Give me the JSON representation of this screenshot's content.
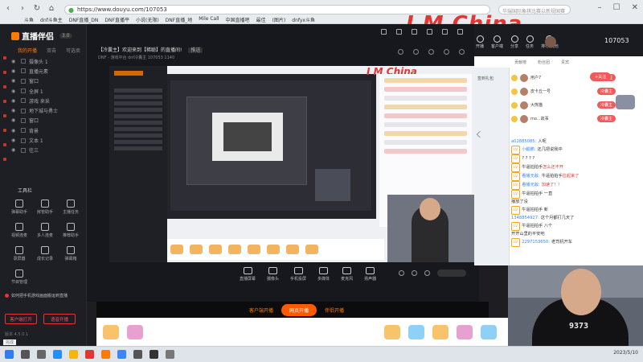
{
  "browser": {
    "url": "https://www.douyu.com/107053",
    "search_placeholder": "华瑞国际象棋比赛以新规国赛",
    "bookmarks": [
      "斗鱼",
      "dnf斗鱼主",
      "DNF直播_DN",
      "DNF直播平",
      "小说(无限)",
      "DNF直播_地",
      "Mile Call",
      "中国直播吧",
      "最佳",
      "(图片)",
      "dnfyx斗鱼"
    ]
  },
  "overlay_text": "I M China",
  "app": {
    "name": "直播伴侣",
    "version": "3.0",
    "tabs": [
      "我的开播",
      "双击",
      "可选卖"
    ],
    "scenes": [
      {
        "label": "摄像头 1"
      },
      {
        "label": "直播元素"
      },
      {
        "label": "窗口"
      },
      {
        "label": "全屏 1"
      },
      {
        "label": "游戏 来采"
      },
      {
        "label": "地下城与勇士"
      },
      {
        "label": "窗口"
      },
      {
        "label": "背景"
      },
      {
        "label": "文本 1"
      },
      {
        "label": "往三"
      }
    ],
    "tools_title": "工具栏",
    "tools": [
      {
        "label": "弹幕助手"
      },
      {
        "label": "房管助手"
      },
      {
        "label": "主播任务"
      },
      {
        "label": "视频连麦"
      },
      {
        "label": "多人连麦"
      },
      {
        "label": "推荐助手"
      },
      {
        "label": "录屏器"
      },
      {
        "label": "成长记录"
      },
      {
        "label": "弹幕箱"
      },
      {
        "label": "节目管理"
      }
    ],
    "notice": "如何把手机游戏画面搬运到直播",
    "buttons": {
      "phone_live": "客户端打开",
      "voice_live": "语音开播"
    },
    "version_text": "版本 4.5.0.1"
  },
  "stream": {
    "room_title": "【冷囊主】欢迎来到【稀聪】的直播间!",
    "tag": "推送",
    "meta": "DNF - 游戏平台  dnf冷囊主  107053  1140",
    "controls": [
      {
        "label": "直播屏幕"
      },
      {
        "label": "摄像头"
      },
      {
        "label": "手机投屏"
      },
      {
        "label": "多媒体"
      },
      {
        "label": "麦克风"
      },
      {
        "label": "扬声器"
      }
    ],
    "live_links": {
      "left": "客户端开播",
      "center": "网页开播",
      "right": "伴侣开播"
    }
  },
  "right_panel": {
    "top_icons": [
      "开播",
      "客户端",
      "分享",
      "任务",
      "排行/其他"
    ],
    "room_id": "107053",
    "header": [
      "贡献榜",
      "粉丝团",
      "贵宾"
    ],
    "sidebar_label": "签到礼包",
    "rank": [
      {
        "name": "用户7",
        "pill": "关注"
      },
      {
        "name": "皮卡丘一号",
        "pill": "冷囊主"
      },
      {
        "name": "大熊猫",
        "pill": "冷囊主"
      },
      {
        "name": "mo...故事",
        "pill": "冷囊主"
      }
    ],
    "follow": "+关注"
  },
  "chat": [
    {
      "level": "",
      "name": "a02885085:",
      "text": "人呢",
      "red": ""
    },
    {
      "level": "LV",
      "name": "小鲲鹏:",
      "text": "还几把说我中",
      "red": ""
    },
    {
      "level": "LV",
      "name": "",
      "text": "? ? ? ?",
      "red": ""
    },
    {
      "level": "LV",
      "name": "",
      "text": "牛逼拍拍手",
      "red": "怎么还不开"
    },
    {
      "level": "LV",
      "name": "看播无敌:",
      "text": "牛逼拍拍手",
      "red": "拉起来了"
    },
    {
      "level": "LV",
      "name": "看播无敌:",
      "text": "",
      "red": "加速了！！"
    },
    {
      "level": "LV",
      "name": "",
      "text": "牛逼拍拍手 一直",
      "red": ""
    },
    {
      "level": "",
      "name": "",
      "text": "播放了没",
      "red": ""
    },
    {
      "level": "LV",
      "name": "",
      "text": "牛逼拍拍手 新",
      "red": ""
    },
    {
      "level": "",
      "name": "1348854927:",
      "text": "这个月都打几天了",
      "red": ""
    },
    {
      "level": "LV",
      "name": "",
      "text": "牛逼拍拍手 八个",
      "red": ""
    },
    {
      "level": "",
      "name": "",
      "text": "开开山里的平安吧",
      "red": ""
    },
    {
      "level": "LV",
      "name": "2297153650:",
      "text": "老司机开车",
      "red": ""
    }
  ],
  "taskbar": {
    "status": "完成",
    "time": "2023/5/10"
  },
  "colors": {
    "accent": "#ff5a00",
    "brand_red": "#e53434"
  }
}
